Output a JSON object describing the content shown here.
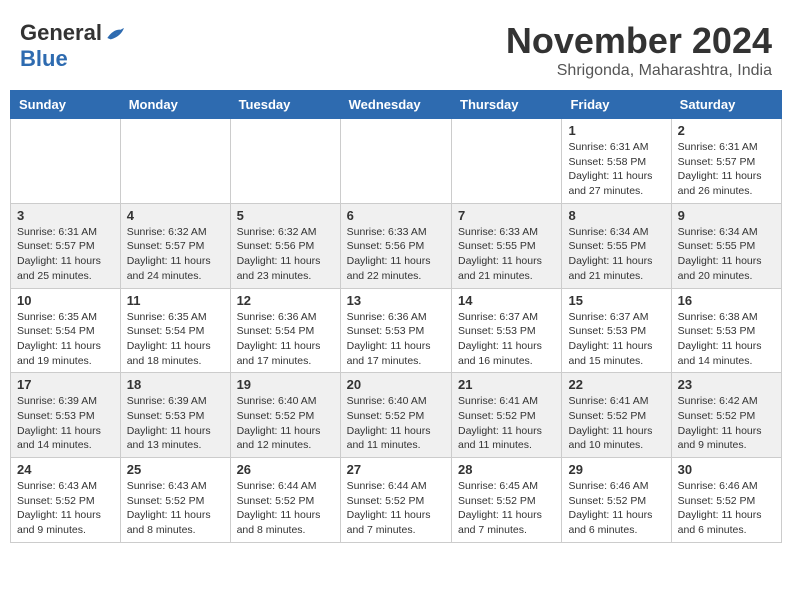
{
  "header": {
    "logo": {
      "general": "General",
      "blue": "Blue"
    },
    "month": "November 2024",
    "location": "Shrigonda, Maharashtra, India"
  },
  "weekdays": [
    "Sunday",
    "Monday",
    "Tuesday",
    "Wednesday",
    "Thursday",
    "Friday",
    "Saturday"
  ],
  "weeks": [
    [
      {
        "day": "",
        "info": ""
      },
      {
        "day": "",
        "info": ""
      },
      {
        "day": "",
        "info": ""
      },
      {
        "day": "",
        "info": ""
      },
      {
        "day": "",
        "info": ""
      },
      {
        "day": "1",
        "info": "Sunrise: 6:31 AM\nSunset: 5:58 PM\nDaylight: 11 hours\nand 27 minutes."
      },
      {
        "day": "2",
        "info": "Sunrise: 6:31 AM\nSunset: 5:57 PM\nDaylight: 11 hours\nand 26 minutes."
      }
    ],
    [
      {
        "day": "3",
        "info": "Sunrise: 6:31 AM\nSunset: 5:57 PM\nDaylight: 11 hours\nand 25 minutes."
      },
      {
        "day": "4",
        "info": "Sunrise: 6:32 AM\nSunset: 5:57 PM\nDaylight: 11 hours\nand 24 minutes."
      },
      {
        "day": "5",
        "info": "Sunrise: 6:32 AM\nSunset: 5:56 PM\nDaylight: 11 hours\nand 23 minutes."
      },
      {
        "day": "6",
        "info": "Sunrise: 6:33 AM\nSunset: 5:56 PM\nDaylight: 11 hours\nand 22 minutes."
      },
      {
        "day": "7",
        "info": "Sunrise: 6:33 AM\nSunset: 5:55 PM\nDaylight: 11 hours\nand 21 minutes."
      },
      {
        "day": "8",
        "info": "Sunrise: 6:34 AM\nSunset: 5:55 PM\nDaylight: 11 hours\nand 21 minutes."
      },
      {
        "day": "9",
        "info": "Sunrise: 6:34 AM\nSunset: 5:55 PM\nDaylight: 11 hours\nand 20 minutes."
      }
    ],
    [
      {
        "day": "10",
        "info": "Sunrise: 6:35 AM\nSunset: 5:54 PM\nDaylight: 11 hours\nand 19 minutes."
      },
      {
        "day": "11",
        "info": "Sunrise: 6:35 AM\nSunset: 5:54 PM\nDaylight: 11 hours\nand 18 minutes."
      },
      {
        "day": "12",
        "info": "Sunrise: 6:36 AM\nSunset: 5:54 PM\nDaylight: 11 hours\nand 17 minutes."
      },
      {
        "day": "13",
        "info": "Sunrise: 6:36 AM\nSunset: 5:53 PM\nDaylight: 11 hours\nand 17 minutes."
      },
      {
        "day": "14",
        "info": "Sunrise: 6:37 AM\nSunset: 5:53 PM\nDaylight: 11 hours\nand 16 minutes."
      },
      {
        "day": "15",
        "info": "Sunrise: 6:37 AM\nSunset: 5:53 PM\nDaylight: 11 hours\nand 15 minutes."
      },
      {
        "day": "16",
        "info": "Sunrise: 6:38 AM\nSunset: 5:53 PM\nDaylight: 11 hours\nand 14 minutes."
      }
    ],
    [
      {
        "day": "17",
        "info": "Sunrise: 6:39 AM\nSunset: 5:53 PM\nDaylight: 11 hours\nand 14 minutes."
      },
      {
        "day": "18",
        "info": "Sunrise: 6:39 AM\nSunset: 5:53 PM\nDaylight: 11 hours\nand 13 minutes."
      },
      {
        "day": "19",
        "info": "Sunrise: 6:40 AM\nSunset: 5:52 PM\nDaylight: 11 hours\nand 12 minutes."
      },
      {
        "day": "20",
        "info": "Sunrise: 6:40 AM\nSunset: 5:52 PM\nDaylight: 11 hours\nand 11 minutes."
      },
      {
        "day": "21",
        "info": "Sunrise: 6:41 AM\nSunset: 5:52 PM\nDaylight: 11 hours\nand 11 minutes."
      },
      {
        "day": "22",
        "info": "Sunrise: 6:41 AM\nSunset: 5:52 PM\nDaylight: 11 hours\nand 10 minutes."
      },
      {
        "day": "23",
        "info": "Sunrise: 6:42 AM\nSunset: 5:52 PM\nDaylight: 11 hours\nand 9 minutes."
      }
    ],
    [
      {
        "day": "24",
        "info": "Sunrise: 6:43 AM\nSunset: 5:52 PM\nDaylight: 11 hours\nand 9 minutes."
      },
      {
        "day": "25",
        "info": "Sunrise: 6:43 AM\nSunset: 5:52 PM\nDaylight: 11 hours\nand 8 minutes."
      },
      {
        "day": "26",
        "info": "Sunrise: 6:44 AM\nSunset: 5:52 PM\nDaylight: 11 hours\nand 8 minutes."
      },
      {
        "day": "27",
        "info": "Sunrise: 6:44 AM\nSunset: 5:52 PM\nDaylight: 11 hours\nand 7 minutes."
      },
      {
        "day": "28",
        "info": "Sunrise: 6:45 AM\nSunset: 5:52 PM\nDaylight: 11 hours\nand 7 minutes."
      },
      {
        "day": "29",
        "info": "Sunrise: 6:46 AM\nSunset: 5:52 PM\nDaylight: 11 hours\nand 6 minutes."
      },
      {
        "day": "30",
        "info": "Sunrise: 6:46 AM\nSunset: 5:52 PM\nDaylight: 11 hours\nand 6 minutes."
      }
    ]
  ]
}
